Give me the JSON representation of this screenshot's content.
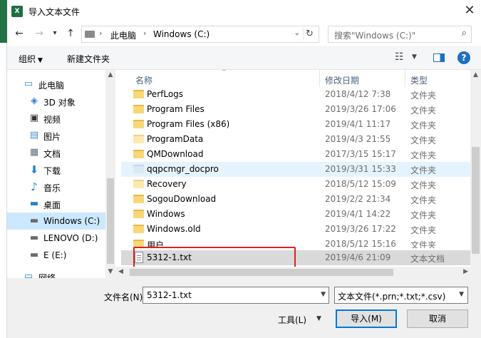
{
  "window": {
    "title": "导入文本文件",
    "app_icon": "excel-icon"
  },
  "address": {
    "crumbs": [
      "此电脑",
      "Windows (C:)"
    ],
    "search_placeholder": "搜索\"Windows (C:)\""
  },
  "toolbar": {
    "organize": "组织",
    "new_folder": "新建文件夹"
  },
  "nav": {
    "items": [
      {
        "label": "此电脑",
        "icon": "computer-icon"
      },
      {
        "label": "3D 对象",
        "icon": "cube-icon"
      },
      {
        "label": "视频",
        "icon": "video-icon"
      },
      {
        "label": "图片",
        "icon": "picture-icon"
      },
      {
        "label": "文档",
        "icon": "document-icon"
      },
      {
        "label": "下载",
        "icon": "download-icon"
      },
      {
        "label": "音乐",
        "icon": "music-icon"
      },
      {
        "label": "桌面",
        "icon": "desktop-icon"
      },
      {
        "label": "Windows (C:)",
        "icon": "drive-icon"
      },
      {
        "label": "LENOVO (D:)",
        "icon": "drive-icon"
      },
      {
        "label": "E (E:)",
        "icon": "drive-icon"
      },
      {
        "label": "网络",
        "icon": "network-icon"
      }
    ]
  },
  "columns": {
    "name": "名称",
    "date": "修改日期",
    "type": "类型"
  },
  "files": [
    {
      "name": "PerfLogs",
      "date": "2018/4/12 7:38",
      "type": "文件夹"
    },
    {
      "name": "Program Files",
      "date": "2019/3/26 17:06",
      "type": "文件夹"
    },
    {
      "name": "Program Files (x86)",
      "date": "2019/4/1 11:17",
      "type": "文件夹"
    },
    {
      "name": "ProgramData",
      "date": "2019/4/3 21:55",
      "type": "文件夹"
    },
    {
      "name": "QMDownload",
      "date": "2017/3/15 15:17",
      "type": "文件夹"
    },
    {
      "name": "qqpcmgr_docpro",
      "date": "2019/3/31 15:33",
      "type": "文件夹"
    },
    {
      "name": "Recovery",
      "date": "2018/5/12 15:09",
      "type": "文件夹"
    },
    {
      "name": "SogouDownload",
      "date": "2019/2/2 21:34",
      "type": "文件夹"
    },
    {
      "name": "Windows",
      "date": "2019/4/1 14:22",
      "type": "文件夹"
    },
    {
      "name": "Windows.old",
      "date": "2019/3/26 17:22",
      "type": "文件夹"
    },
    {
      "name": "用户",
      "date": "2018/5/12 15:16",
      "type": "文件夹"
    },
    {
      "name": "5312-1.txt",
      "date": "2019/4/6 21:09",
      "type": "文本文档"
    }
  ],
  "bottom": {
    "filename_label": "文件名(N):",
    "filename_value": "5312-1.txt",
    "filter_value": "文本文件(*.prn;*.txt;*.csv)",
    "tools": "工具(L)",
    "import": "导入(M)",
    "cancel": "取消"
  }
}
